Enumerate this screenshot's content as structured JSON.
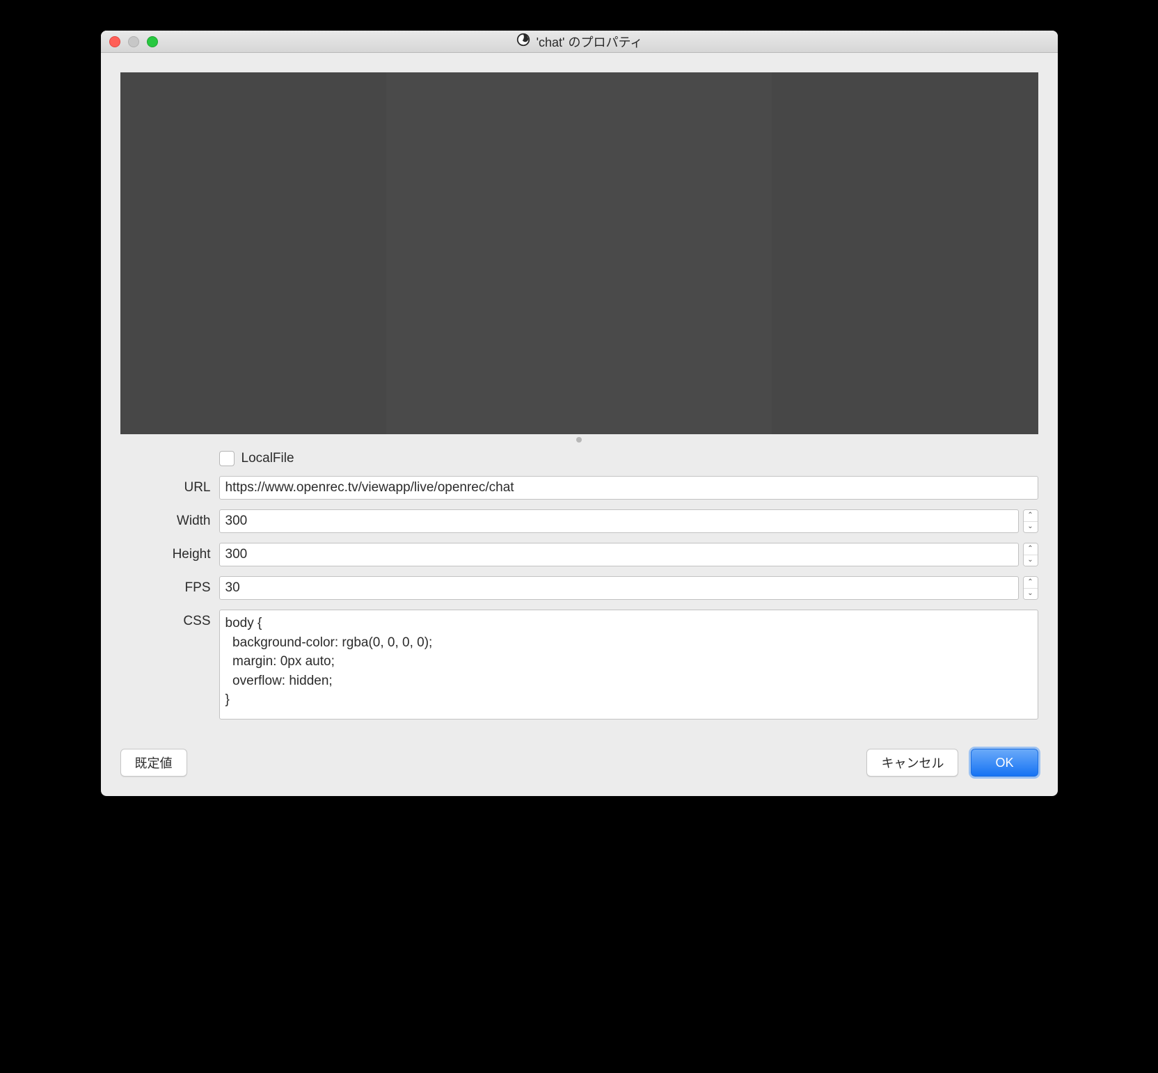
{
  "window": {
    "title": "'chat' のプロパティ",
    "app_icon": "obs-icon"
  },
  "form": {
    "localfile": {
      "label": "LocalFile",
      "checked": false
    },
    "url": {
      "label": "URL",
      "value": "https://www.openrec.tv/viewapp/live/openrec/chat"
    },
    "width": {
      "label": "Width",
      "value": "300"
    },
    "height": {
      "label": "Height",
      "value": "300"
    },
    "fps": {
      "label": "FPS",
      "value": "30"
    },
    "css": {
      "label": "CSS",
      "value": "body {\n  background-color: rgba(0, 0, 0, 0);\n  margin: 0px auto;\n  overflow: hidden;\n}"
    }
  },
  "buttons": {
    "defaults": "既定値",
    "cancel": "キャンセル",
    "ok": "OK"
  }
}
